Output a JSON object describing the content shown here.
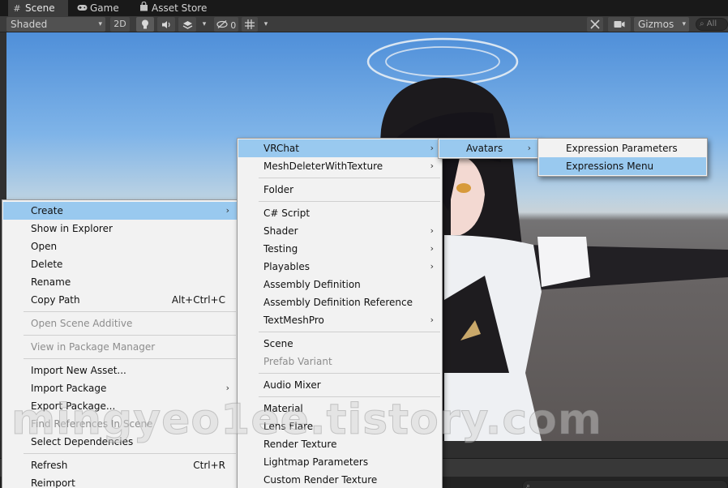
{
  "tabs": [
    {
      "label": "Scene",
      "icon": "hash-icon"
    },
    {
      "label": "Game",
      "icon": "gamepad-icon"
    },
    {
      "label": "Asset Store",
      "icon": "shopping-bag-icon"
    }
  ],
  "toolbar": {
    "shading_mode": "Shaded",
    "mode_2d": "2D",
    "hidden_count": "0",
    "gizmos": "Gizmos",
    "search_placeholder": "All"
  },
  "context_menu": {
    "items": [
      {
        "label": "Create",
        "submenu": true,
        "highlighted": true
      },
      {
        "label": "Show in Explorer"
      },
      {
        "label": "Open"
      },
      {
        "label": "Delete"
      },
      {
        "label": "Rename"
      },
      {
        "label": "Copy Path",
        "shortcut": "Alt+Ctrl+C"
      },
      {
        "label": "Open Scene Additive",
        "disabled": true
      },
      {
        "label": "View in Package Manager",
        "disabled": true
      },
      {
        "label": "Import New Asset..."
      },
      {
        "label": "Import Package",
        "submenu": true
      },
      {
        "label": "Export Package..."
      },
      {
        "label": "Find References In Scene",
        "disabled": true
      },
      {
        "label": "Select Dependencies"
      },
      {
        "label": "Refresh",
        "shortcut": "Ctrl+R"
      },
      {
        "label": "Reimport"
      }
    ]
  },
  "create_menu": {
    "items": [
      {
        "label": "VRChat",
        "submenu": true,
        "highlighted": true
      },
      {
        "label": "MeshDeleterWithTexture",
        "submenu": true
      },
      {
        "label": "Folder"
      },
      {
        "label": "C# Script"
      },
      {
        "label": "Shader",
        "submenu": true
      },
      {
        "label": "Testing",
        "submenu": true
      },
      {
        "label": "Playables",
        "submenu": true
      },
      {
        "label": "Assembly Definition"
      },
      {
        "label": "Assembly Definition Reference"
      },
      {
        "label": "TextMeshPro",
        "submenu": true
      },
      {
        "label": "Scene"
      },
      {
        "label": "Prefab Variant",
        "disabled": true
      },
      {
        "label": "Audio Mixer"
      },
      {
        "label": "Material"
      },
      {
        "label": "Lens Flare"
      },
      {
        "label": "Render Texture"
      },
      {
        "label": "Lightmap Parameters"
      },
      {
        "label": "Custom Render Texture"
      }
    ]
  },
  "vrchat_menu": {
    "items": [
      {
        "label": "Avatars",
        "submenu": true,
        "highlighted": true
      }
    ]
  },
  "avatars_menu": {
    "items": [
      {
        "label": "Expression Parameters"
      },
      {
        "label": "Expressions Menu",
        "highlighted": true
      }
    ]
  },
  "watermark": "mingyeo1ee.tistory.com",
  "glyphs": {
    "submenu_arrow": "›",
    "dropdown_arrow": "▾"
  }
}
